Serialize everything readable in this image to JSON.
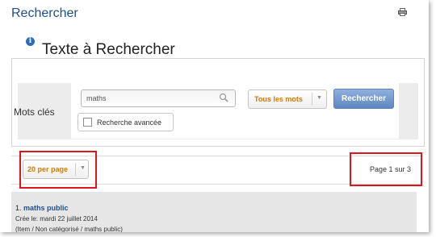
{
  "header": {
    "title": "Rechercher",
    "print_icon": "printer-icon"
  },
  "section": {
    "title": "Texte à Rechercher",
    "info_icon": "info-icon"
  },
  "search": {
    "keywords_label": "Mots clés",
    "query_value": "maths",
    "mode_selected": "Tous les mots",
    "submit_label": "Rechercher",
    "advanced_label": "Recherche avancée",
    "advanced_checked": false
  },
  "pager": {
    "per_page_selected": "20 per page",
    "page_info": "Page 1 sur 3"
  },
  "results": [
    {
      "index": "1.",
      "title": "maths public",
      "date_line": "Crée le: mardi 22 juillet 2014",
      "path_line": "(Item / Non catégorisé / maths public)"
    }
  ],
  "colors": {
    "link": "#1f4e8c",
    "accent_orange": "#d87a00",
    "button_blue": "#5e88c2",
    "highlight_red": "#e0151b"
  }
}
